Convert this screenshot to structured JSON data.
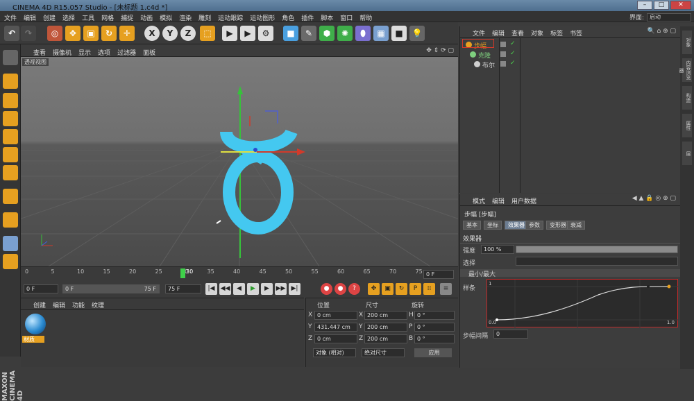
{
  "app": {
    "title": "CINEMA 4D R15.057 Studio - [未标题 1.c4d *]",
    "brand": "MAXON",
    "brand_sub": "CINEMA 4D"
  },
  "menubar": {
    "items": [
      "文件",
      "编辑",
      "创建",
      "选择",
      "工具",
      "网格",
      "捕捉",
      "动画",
      "模拟",
      "渲染",
      "雕刻",
      "运动跟踪",
      "运动图形",
      "角色",
      "插件",
      "脚本",
      "窗口",
      "帮助"
    ],
    "layout_label": "界面:",
    "layout_value": "启动"
  },
  "viewport": {
    "menu": [
      "查看",
      "摄像机",
      "显示",
      "选项",
      "过滤器",
      "面板"
    ],
    "label": "透视视图"
  },
  "timeline": {
    "ticks": [
      "0",
      "5",
      "10",
      "15",
      "20",
      "25",
      "30",
      "35",
      "40",
      "45",
      "50",
      "55",
      "60",
      "65",
      "70",
      "75"
    ],
    "current_frame": "30",
    "end": "0 F"
  },
  "transport": {
    "start": "0 F",
    "range_start": "0 F",
    "range_end": "75 F",
    "end": "75 F"
  },
  "materials": {
    "menu": [
      "创建",
      "编辑",
      "功能",
      "纹理"
    ],
    "material_name": "材质"
  },
  "coords": {
    "headers": [
      "位置",
      "尺寸",
      "旋转"
    ],
    "rows": [
      {
        "axis": "X",
        "pos": "0 cm",
        "size": "200 cm",
        "rot_axis": "H",
        "rot": "0 °"
      },
      {
        "axis": "Y",
        "pos": "431.447 cm",
        "size": "200 cm",
        "rot_axis": "P",
        "rot": "0 °"
      },
      {
        "axis": "Z",
        "pos": "0 cm",
        "size": "200 cm",
        "rot_axis": "B",
        "rot": "0 °"
      }
    ],
    "mode": "对象 (相对)",
    "size_mode": "绝对尺寸",
    "apply": "应用"
  },
  "objects": {
    "menu": [
      "文件",
      "编辑",
      "查看",
      "对象",
      "标签",
      "书签"
    ],
    "items": [
      {
        "name": "步幅",
        "color": "#e8a020"
      },
      {
        "name": "克隆",
        "color": "#7fd07f"
      },
      {
        "name": "布尔",
        "color": "#d0d0d0"
      }
    ]
  },
  "attributes": {
    "menu": [
      "模式",
      "编辑",
      "用户数据"
    ],
    "object": "步幅 [步幅]",
    "tabs": [
      "基本",
      "坐标",
      "效果器",
      "参数",
      "变形器",
      "衰减"
    ],
    "active_tab": "效果器",
    "section": "效果器",
    "strength_label": "强度",
    "strength_value": "100 %",
    "select_label": "选择",
    "minmax": "最小/最大",
    "spline_label": "样条",
    "step_gap_label": "步幅间隔",
    "step_gap_value": "0",
    "graph_y": "1",
    "graph_x_start": "0.0",
    "graph_x_end": "1.0"
  },
  "righttabs": [
    "对象",
    "内容浏览器",
    "构造",
    "属性",
    "层"
  ]
}
